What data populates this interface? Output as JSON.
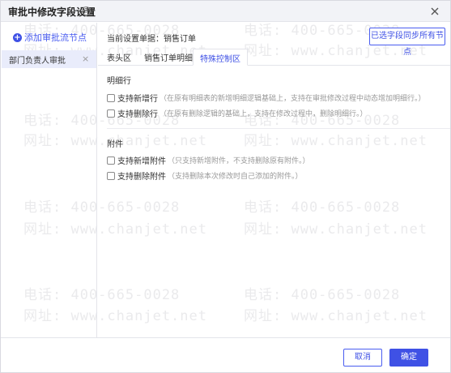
{
  "dialog": {
    "title": "审批中修改字段设置",
    "help_icon": "?",
    "close_icon": "close-icon"
  },
  "sidebar": {
    "add_node_label": "添加审批流节点",
    "nodes": [
      {
        "label": "部门负责人审批",
        "remove": "×"
      }
    ]
  },
  "main": {
    "doc_label": "当前设置单据：销售订单",
    "sync_button": "已选字段同步所有节点",
    "tabs": [
      {
        "label": "表头区",
        "active": false
      },
      {
        "label": "销售订单明细",
        "active": false
      },
      {
        "label": "特殊控制区",
        "active": true
      }
    ],
    "sections": [
      {
        "title": "明细行",
        "options": [
          {
            "label": "支持新增行",
            "hint": "（在原有明细表的新增明细逻辑基础上，支持在审批修改过程中动态增加明细行。）",
            "checked": false
          },
          {
            "label": "支持删除行",
            "hint": "（在原有删除逻辑的基础上，支持在修改过程中，删除明细行。）",
            "checked": false
          }
        ]
      },
      {
        "title": "附件",
        "options": [
          {
            "label": "支持新增附件",
            "hint": "（只支持新增附件，不支持删除原有附件。）",
            "checked": false
          },
          {
            "label": "支持删除附件",
            "hint": "（支持删除本次修改时自己添加的附件。）",
            "checked": false
          }
        ]
      }
    ]
  },
  "footer": {
    "cancel_label": "取消",
    "ok_label": "确定"
  },
  "watermark": {
    "phone": "电话: 400-665-0028",
    "site": "网址: www.chanjet.net"
  },
  "colors": {
    "accent": "#3f51e5",
    "title_bg": "#f2f3f7",
    "selected_bg": "#e9ecfb"
  }
}
